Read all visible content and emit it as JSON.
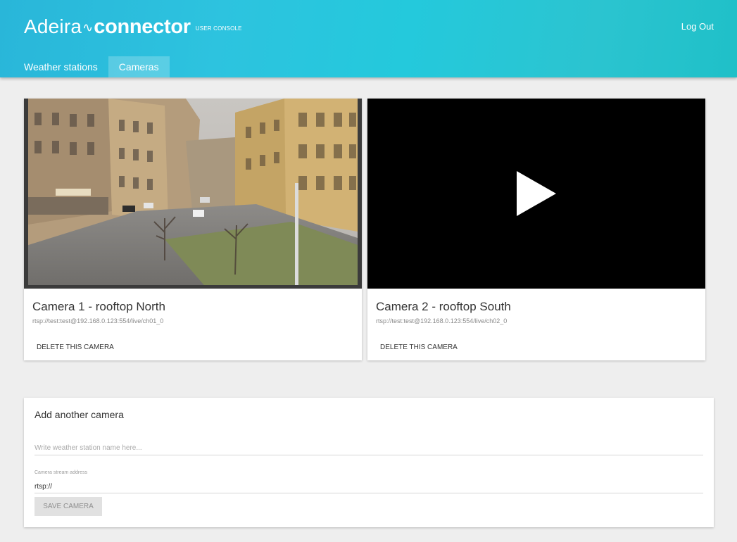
{
  "header": {
    "brand": "Adeira",
    "wave": "∿",
    "product": "connector",
    "tagline": "USER CONSOLE",
    "logout_label": "Log Out"
  },
  "nav": {
    "tabs": [
      {
        "label": "Weather stations",
        "active": false
      },
      {
        "label": "Cameras",
        "active": true
      }
    ]
  },
  "cameras": [
    {
      "name": "Camera 1 - rooftop North",
      "url": "rtsp://test:test@192.168.0.123:554/live/ch01_0",
      "delete_label": "DELETE THIS CAMERA",
      "preview": "street-snapshot"
    },
    {
      "name": "Camera 2 - rooftop South",
      "url": "rtsp://test:test@192.168.0.123:554/live/ch02_0",
      "delete_label": "DELETE THIS CAMERA",
      "preview": "play-icon"
    }
  ],
  "add_form": {
    "title": "Add another camera",
    "name_placeholder": "Write weather station name here...",
    "stream_label": "Camera stream address",
    "stream_value": "rtsp://",
    "save_label": "SAVE CAMERA"
  },
  "colors": {
    "header_accent": "#2bc4dc",
    "card_bg": "#ffffff",
    "page_bg": "#eeeeee"
  }
}
